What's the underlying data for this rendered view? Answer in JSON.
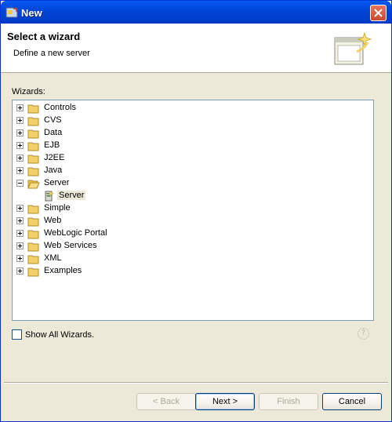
{
  "window": {
    "title": "New"
  },
  "banner": {
    "title": "Select a wizard",
    "description": "Define a new server"
  },
  "wizards": {
    "label": "Wizards:",
    "items": [
      {
        "label": "Controls",
        "expanded": false,
        "icon": "folder-icon"
      },
      {
        "label": "CVS",
        "expanded": false,
        "icon": "folder-icon"
      },
      {
        "label": "Data",
        "expanded": false,
        "icon": "folder-icon"
      },
      {
        "label": "EJB",
        "expanded": false,
        "icon": "folder-icon"
      },
      {
        "label": "J2EE",
        "expanded": false,
        "icon": "folder-icon"
      },
      {
        "label": "Java",
        "expanded": false,
        "icon": "folder-icon"
      },
      {
        "label": "Server",
        "expanded": true,
        "icon": "open-folder-icon",
        "children": [
          {
            "label": "Server",
            "icon": "server-wizard-icon",
            "selected": true
          }
        ]
      },
      {
        "label": "Simple",
        "expanded": false,
        "icon": "folder-icon"
      },
      {
        "label": "Web",
        "expanded": false,
        "icon": "folder-icon"
      },
      {
        "label": "WebLogic Portal",
        "expanded": false,
        "icon": "folder-icon"
      },
      {
        "label": "Web Services",
        "expanded": false,
        "icon": "folder-icon"
      },
      {
        "label": "XML",
        "expanded": false,
        "icon": "folder-icon"
      },
      {
        "label": "Examples",
        "expanded": false,
        "icon": "folder-icon"
      }
    ]
  },
  "options": {
    "show_all_label": "Show All Wizards.",
    "show_all_checked": false
  },
  "help": {
    "glyph": "?"
  },
  "buttons": {
    "back": {
      "label": "< Back",
      "enabled": false
    },
    "next": {
      "label": "Next >",
      "enabled": true
    },
    "finish": {
      "label": "Finish",
      "enabled": false
    },
    "cancel": {
      "label": "Cancel",
      "enabled": true
    }
  },
  "colors": {
    "titlebar": "#0044d6",
    "dialog": "#ece9d8",
    "folder": "#f2d16b"
  }
}
